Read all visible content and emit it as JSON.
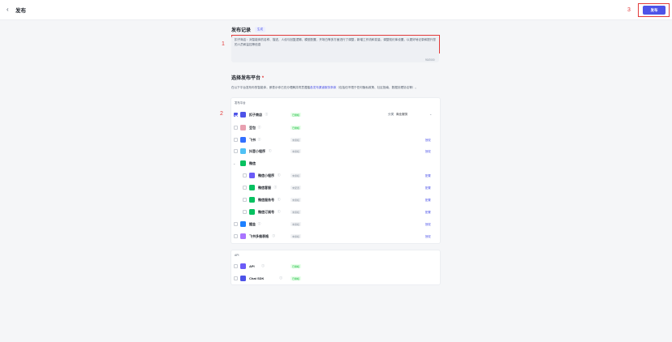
{
  "header": {
    "back_icon": "‹",
    "title": "发布",
    "publish_label": "发布"
  },
  "annotations": [
    "1",
    "2",
    "3"
  ],
  "record": {
    "title": "发布记录",
    "generate_label": "生成",
    "text": "扣子商店：对智能体的名称、描述、人设与回复逻辑、模型配置、开场白等多方面进行了调整，新增工作流和变量，调整知识库设置，以更好地记录和提升您的人员和监控等信息",
    "count": "90/2000"
  },
  "platform": {
    "title": "选择发布平台",
    "required_mark": "*",
    "desc_pre": "在以下平台发布你的智能体，即表示你已充分理解并同意遵循",
    "desc_link": "各发布渠道服务条款",
    "desc_post": "（包括但不限于任何隐私政策、社区指南、数据处理协议等）。",
    "group_store": "发布平台",
    "group_api": "API",
    "category_label": "分类",
    "category_value": "商业服务",
    "category_arrow": "⌄",
    "auth_label": "授权",
    "info_icon": "ⓘ",
    "expand_icon": "⌄"
  },
  "platforms": [
    {
      "name": "扣子商店",
      "status": "已授权",
      "color": "#4d53e8",
      "checked": true
    },
    {
      "name": "豆包",
      "status": "已授权",
      "color": "#e8a0b0"
    },
    {
      "name": "飞书",
      "status": "未授权",
      "color": "#3370ff",
      "auth": "授权"
    },
    {
      "name": "抖音小程序",
      "status": "未授权",
      "color": "#4fc1f5",
      "auth": "授权"
    },
    {
      "name": "微信",
      "color": "#07c160",
      "group": true
    },
    {
      "name": "微信小程序",
      "status": "未授权",
      "color": "#6b5bf7",
      "auth": "配置",
      "indent": true
    },
    {
      "name": "微信客服",
      "status": "未配置",
      "color": "#07c160",
      "auth": "配置",
      "indent": true
    },
    {
      "name": "微信服务号",
      "status": "未授权",
      "color": "#07c160",
      "auth": "配置",
      "indent": true
    },
    {
      "name": "微信订阅号",
      "status": "未授权",
      "color": "#07c160",
      "auth": "配置",
      "indent": true
    },
    {
      "name": "掘金",
      "status": "未授权",
      "color": "#1e80ff",
      "auth": "授权"
    },
    {
      "name": "飞书多维表格",
      "status": "未授权",
      "color": "#a974ff",
      "auth": "授权"
    }
  ],
  "api_platforms": [
    {
      "name": "API",
      "status": "已授权",
      "color": "#6b5bf7"
    },
    {
      "name": "Chat SDK",
      "status": "已授权",
      "color": "#4d53e8"
    }
  ],
  "colors": {
    "accent": "#4d53e8",
    "annotation": "#e23b3b"
  }
}
